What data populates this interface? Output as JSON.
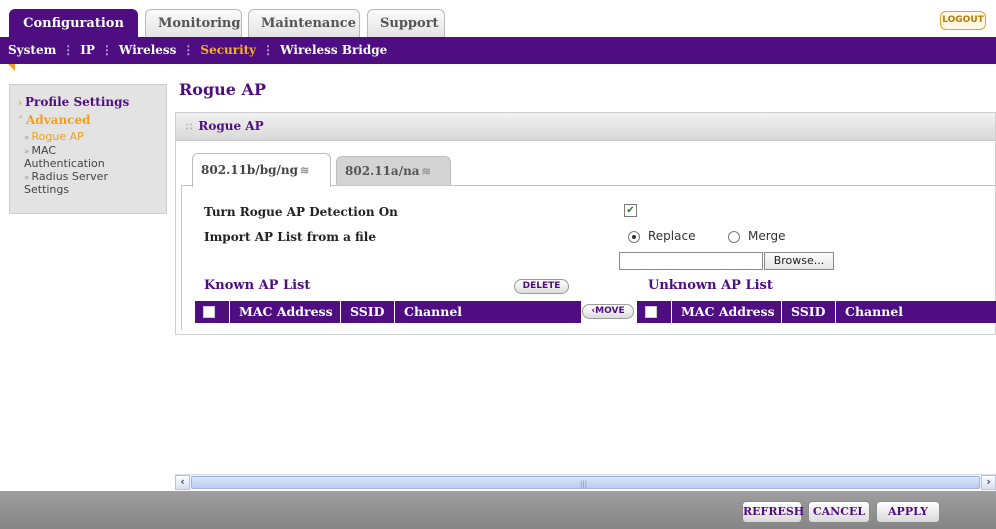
{
  "top_tabs": [
    {
      "label": "Configuration",
      "active": true
    },
    {
      "label": "Monitoring",
      "active": false
    },
    {
      "label": "Maintenance",
      "active": false
    },
    {
      "label": "Support",
      "active": false
    }
  ],
  "logout_label": "LOGOUT",
  "subnav": [
    {
      "label": "System",
      "active": false
    },
    {
      "label": "IP",
      "active": false
    },
    {
      "label": "Wireless",
      "active": false
    },
    {
      "label": "Security",
      "active": true
    },
    {
      "label": "Wireless Bridge",
      "active": false
    }
  ],
  "sidebar": {
    "profile_settings": "Profile Settings",
    "advanced": "Advanced",
    "items": [
      {
        "label": "Rogue AP",
        "active": true
      },
      {
        "label": "MAC Authentication",
        "active": false
      },
      {
        "label": "Radius Server Settings",
        "active": false
      }
    ]
  },
  "page_title": "Rogue AP",
  "section_title": "Rogue AP",
  "band_tabs": [
    {
      "label": "802.11b/bg/ng",
      "active": true
    },
    {
      "label": "802.11a/na",
      "active": false
    }
  ],
  "form": {
    "detection_label": "Turn Rogue AP Detection On",
    "detection_checked": true,
    "import_label": "Import AP List from a file",
    "replace_label": "Replace",
    "merge_label": "Merge",
    "selected_mode": "Replace",
    "file_value": "",
    "browse_label": "Browse..."
  },
  "known_list": {
    "title": "Known AP List",
    "delete_label": "DELETE",
    "columns": [
      "MAC Address",
      "SSID",
      "Channel"
    ]
  },
  "move_label": "MOVE",
  "unknown_list": {
    "title": "Unknown AP List",
    "columns": [
      "MAC Address",
      "SSID",
      "Channel"
    ]
  },
  "footer": {
    "refresh_label": "REFRESH",
    "cancel_label": "CANCEL",
    "apply_label": "APPLY"
  },
  "colors": {
    "brand_purple": "#4e0e82",
    "accent_orange": "#f0a01e"
  }
}
